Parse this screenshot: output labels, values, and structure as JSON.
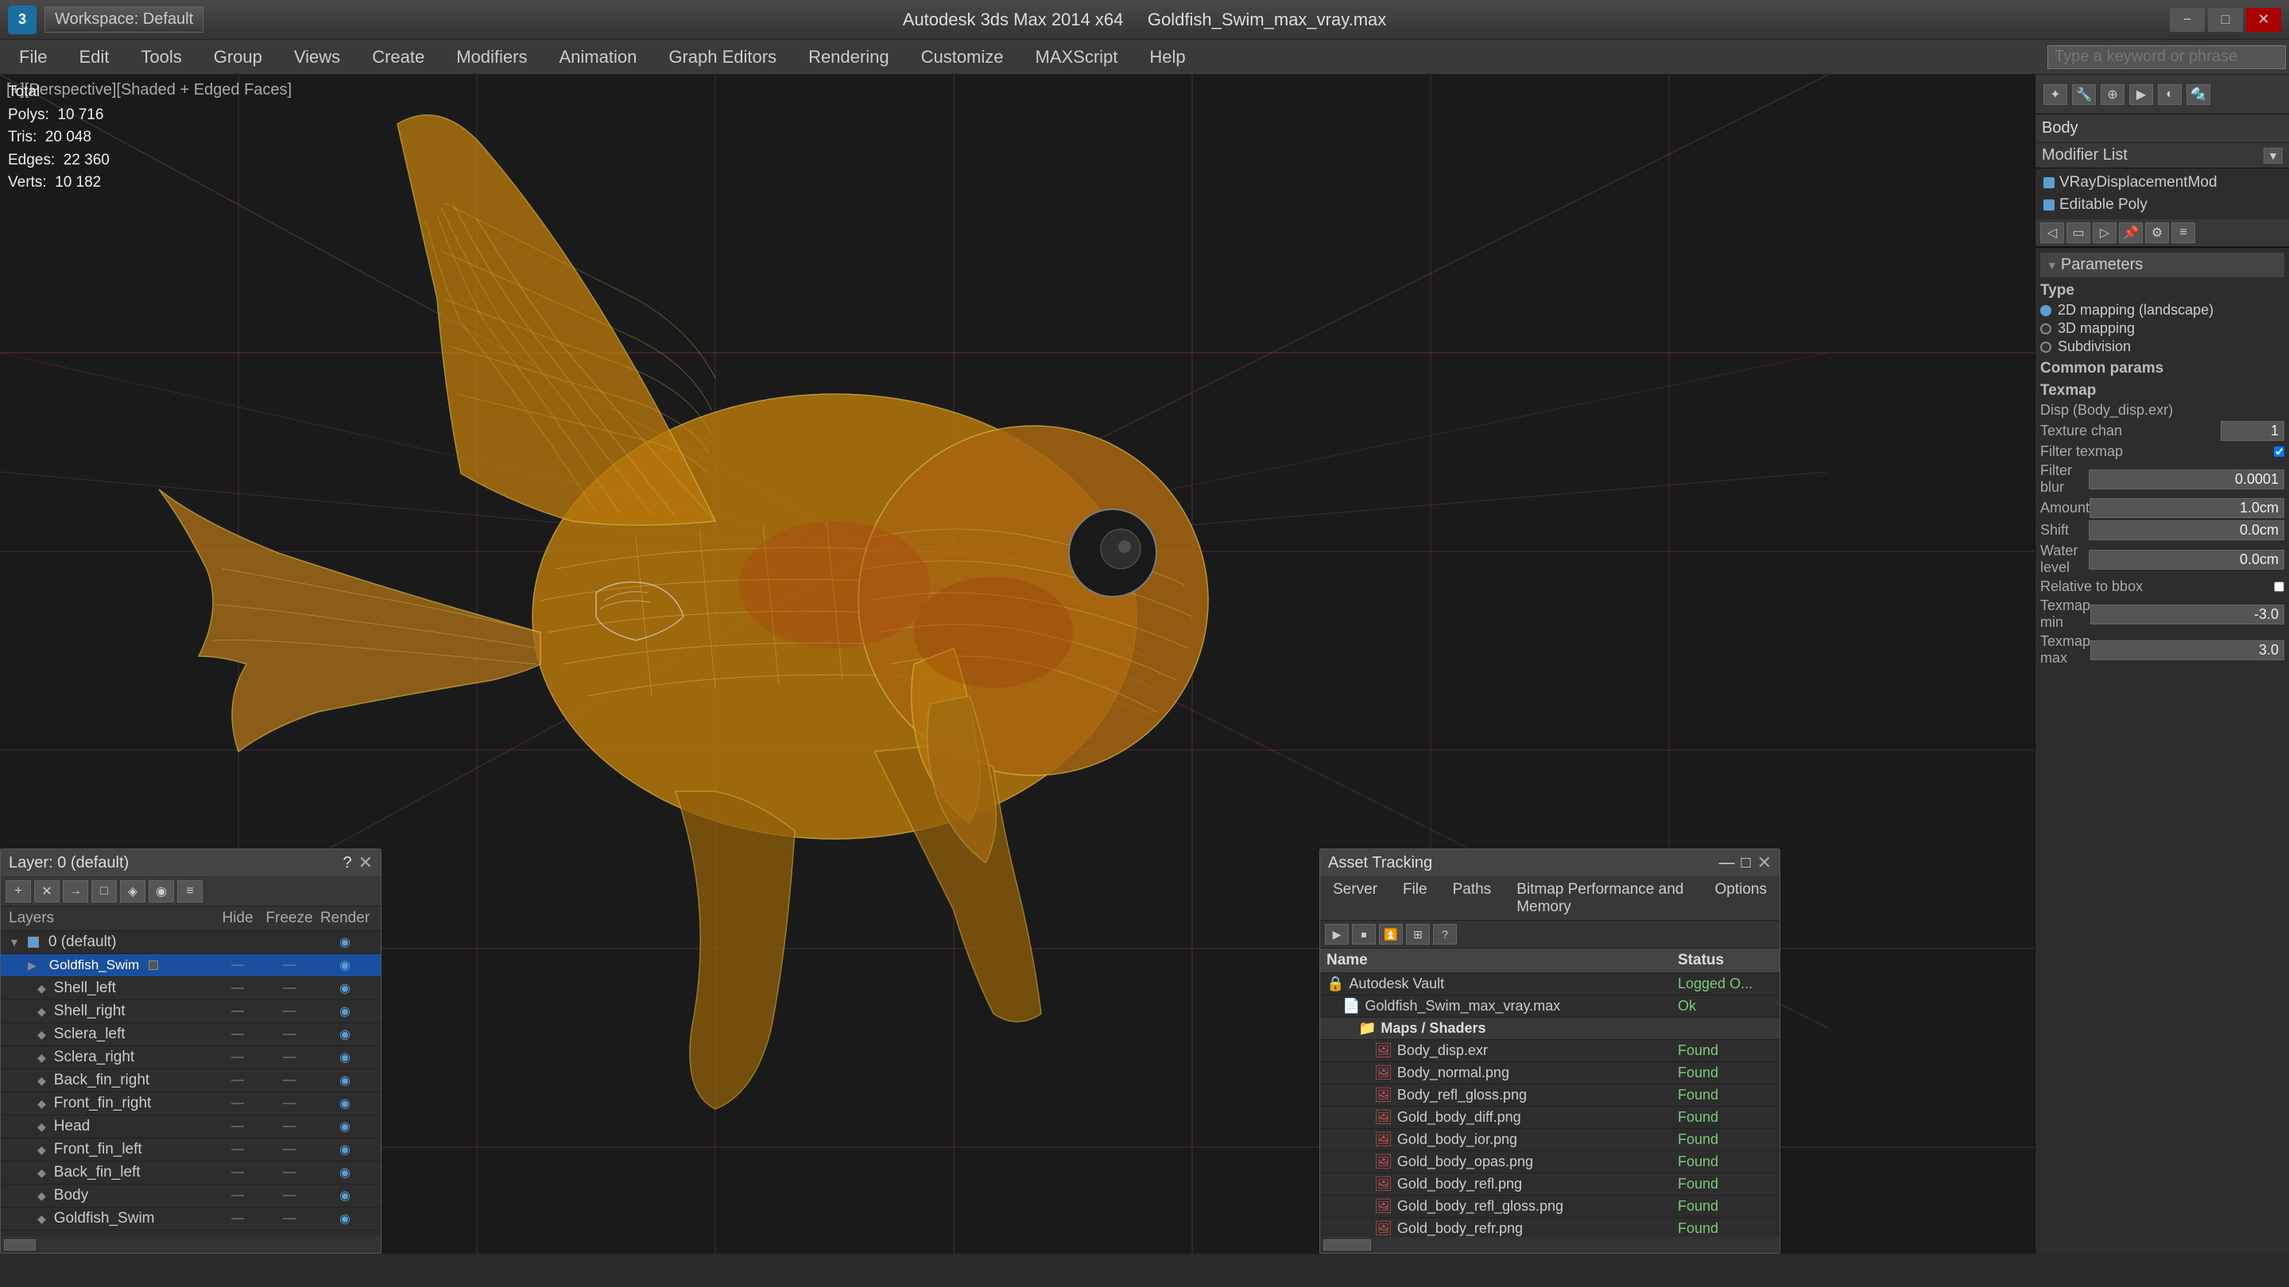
{
  "titlebar": {
    "app_name": "3ds Max",
    "file_name": "Goldfish_Swim_max_vray.max",
    "version": "Autodesk 3ds Max 2014 x64",
    "workspace": "Workspace: Default",
    "minimize": "−",
    "maximize": "□",
    "close": "✕"
  },
  "search": {
    "placeholder": "Type a keyword or phrase"
  },
  "menubar": {
    "items": [
      {
        "label": "File"
      },
      {
        "label": "Edit"
      },
      {
        "label": "Tools"
      },
      {
        "label": "Group"
      },
      {
        "label": "Views"
      },
      {
        "label": "Create"
      },
      {
        "label": "Modifiers"
      },
      {
        "label": "Animation"
      },
      {
        "label": "Graph Editors"
      },
      {
        "label": "Rendering"
      },
      {
        "label": "Customize"
      },
      {
        "label": "MAXScript"
      },
      {
        "label": "Help"
      }
    ]
  },
  "viewport": {
    "label": "[+][Perspective][Shaded + Edged Faces]",
    "stats": {
      "polys_label": "Polys:",
      "polys_value": "10 716",
      "tris_label": "Tris:",
      "tris_value": "20 048",
      "edges_label": "Edges:",
      "edges_value": "22 360",
      "verts_label": "Verts:",
      "verts_value": "10 182"
    }
  },
  "right_panel": {
    "body_label": "Body",
    "modifier_list_label": "Modifier List",
    "modifiers": [
      {
        "name": "VRayDisplacementMod"
      },
      {
        "name": "Editable Poly"
      }
    ],
    "params_title": "Parameters",
    "type_label": "Type",
    "type_options": [
      {
        "label": "2D mapping (landscape)",
        "selected": true
      },
      {
        "label": "3D mapping",
        "selected": false
      },
      {
        "label": "Subdivision",
        "selected": false
      }
    ],
    "common_params_label": "Common params",
    "texmap_label": "Texmap",
    "disp_label": "Disp (Body_disp.exr)",
    "texture_chan_label": "Texture chan",
    "texture_chan_value": "1",
    "filter_texmap_label": "Filter texmap",
    "filter_blur_label": "Filter blur",
    "filter_blur_value": "0.0001",
    "amount_label": "Amount",
    "amount_value": "1.0cm",
    "shift_label": "Shift",
    "shift_value": "0.0cm",
    "water_level_label": "Water level",
    "water_level_value": "0.0cm",
    "relative_to_bbox_label": "Relative to bbox",
    "texmap_min_label": "Texmap min",
    "texmap_min_value": "-3.0",
    "texmap_max_label": "Texmap max",
    "texmap_max_value": "3.0"
  },
  "layers_panel": {
    "title": "Layer: 0 (default)",
    "columns": {
      "name": "Layers",
      "hide": "Hide",
      "freeze": "Freeze",
      "render": "Render"
    },
    "items": [
      {
        "name": "0 (default)",
        "hide": "",
        "freeze": "",
        "render": "",
        "level": 0,
        "expanded": true,
        "selected": false
      },
      {
        "name": "Goldfish_Swim",
        "hide": "",
        "freeze": "",
        "render": "",
        "level": 1,
        "expanded": false,
        "selected": true
      },
      {
        "name": "Shell_left",
        "hide": "—",
        "freeze": "—",
        "render": "",
        "level": 2,
        "selected": false
      },
      {
        "name": "Shell_right",
        "hide": "—",
        "freeze": "—",
        "render": "",
        "level": 2,
        "selected": false
      },
      {
        "name": "Sclera_left",
        "hide": "—",
        "freeze": "—",
        "render": "",
        "level": 2,
        "selected": false
      },
      {
        "name": "Sclera_right",
        "hide": "—",
        "freeze": "—",
        "render": "",
        "level": 2,
        "selected": false
      },
      {
        "name": "Back_fin_right",
        "hide": "—",
        "freeze": "—",
        "render": "",
        "level": 2,
        "selected": false
      },
      {
        "name": "Front_fin_right",
        "hide": "—",
        "freeze": "—",
        "render": "",
        "level": 2,
        "selected": false
      },
      {
        "name": "Head",
        "hide": "—",
        "freeze": "—",
        "render": "",
        "level": 2,
        "selected": false
      },
      {
        "name": "Front_fin_left",
        "hide": "—",
        "freeze": "—",
        "render": "",
        "level": 2,
        "selected": false
      },
      {
        "name": "Back_fin_left",
        "hide": "—",
        "freeze": "—",
        "render": "",
        "level": 2,
        "selected": false
      },
      {
        "name": "Body",
        "hide": "—",
        "freeze": "—",
        "render": "",
        "level": 2,
        "selected": false
      },
      {
        "name": "Goldfish_Swim",
        "hide": "—",
        "freeze": "—",
        "render": "",
        "level": 2,
        "selected": false
      }
    ]
  },
  "asset_panel": {
    "title": "Asset Tracking",
    "menu": [
      "Server",
      "File",
      "Paths",
      "Bitmap Performance and Memory",
      "Options"
    ],
    "columns": {
      "name": "Name",
      "status": "Status"
    },
    "items": [
      {
        "name": "Autodesk Vault",
        "status": "Logged O...",
        "level": 0,
        "type": "vault"
      },
      {
        "name": "Goldfish_Swim_max_vray.max",
        "status": "Ok",
        "level": 1,
        "type": "file"
      },
      {
        "name": "Maps / Shaders",
        "status": "",
        "level": 2,
        "type": "folder"
      },
      {
        "name": "Body_disp.exr",
        "status": "Found",
        "level": 3,
        "type": "img"
      },
      {
        "name": "Body_normal.png",
        "status": "Found",
        "level": 3,
        "type": "img"
      },
      {
        "name": "Body_refl_gloss.png",
        "status": "Found",
        "level": 3,
        "type": "img"
      },
      {
        "name": "Gold_body_diff.png",
        "status": "Found",
        "level": 3,
        "type": "img"
      },
      {
        "name": "Gold_body_ior.png",
        "status": "Found",
        "level": 3,
        "type": "img"
      },
      {
        "name": "Gold_body_opas.png",
        "status": "Found",
        "level": 3,
        "type": "img"
      },
      {
        "name": "Gold_body_refl.png",
        "status": "Found",
        "level": 3,
        "type": "img"
      },
      {
        "name": "Gold_body_refl_gloss.png",
        "status": "Found",
        "level": 3,
        "type": "img"
      },
      {
        "name": "Gold_body_refr.png",
        "status": "Found",
        "level": 3,
        "type": "img"
      }
    ]
  }
}
